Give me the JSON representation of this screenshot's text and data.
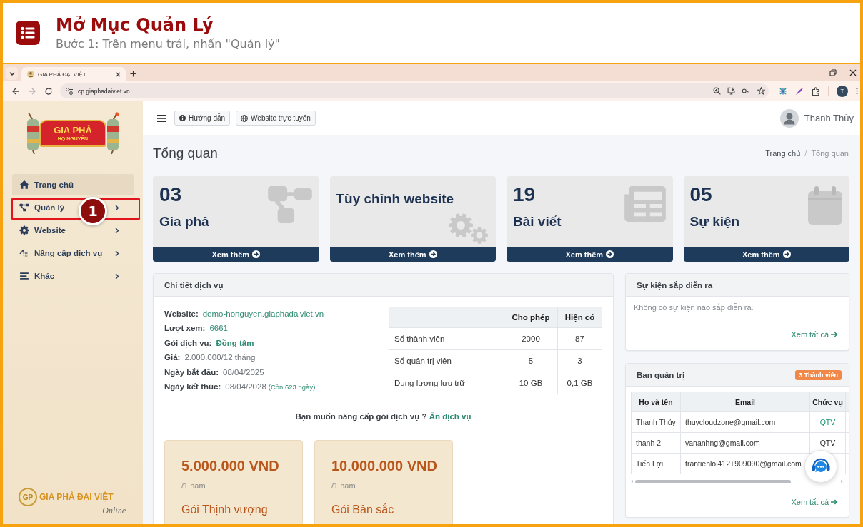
{
  "tutorial": {
    "title": "Mở Mục Quản Lý",
    "subtitle": "Bước 1: Trên menu trái, nhấn \"Quản lý\""
  },
  "browser": {
    "tabs": [
      {
        "title": "GIA PHẢ ĐẠI VIỆT",
        "selected": true
      }
    ],
    "forward_disabled": true,
    "address": "cp.giaphadaiviet.vn",
    "profile_initial": "T"
  },
  "sidebar": {
    "logo": {
      "title": "GIA PHẢ",
      "subtitle": "HỌ NGUYỄN"
    },
    "items": [
      {
        "label": "Trang chủ",
        "selected": true,
        "highlighted": false,
        "has_submenu": false
      },
      {
        "label": "Quản lý",
        "selected": false,
        "highlighted": true,
        "has_submenu": true
      },
      {
        "label": "Website",
        "selected": false,
        "highlighted": false,
        "has_submenu": true
      },
      {
        "label": "Nâng cấp dịch vụ",
        "selected": false,
        "highlighted": false,
        "has_submenu": true
      },
      {
        "label": "Khác",
        "selected": false,
        "highlighted": false,
        "has_submenu": true
      }
    ],
    "step_marker": "1",
    "footer_logo": {
      "emblem": "GP",
      "name": "GIA PHẢ ĐẠI VIỆT",
      "tagline": "Online"
    }
  },
  "navbar": {
    "buttons": [
      {
        "label": "Hướng dẫn"
      },
      {
        "label": "Website trực tuyến"
      }
    ],
    "user_name": "Thanh Thủy"
  },
  "page": {
    "title": "Tổng quan",
    "breadcrumb": [
      {
        "label": "Trang chủ",
        "selected": false
      },
      {
        "label": "Tổng quan",
        "selected": true
      }
    ],
    "breadcrumb_separator": "/"
  },
  "stat_cards": [
    {
      "kind": "count",
      "value": "03",
      "label": "Gia phả",
      "link": "Xem thêm"
    },
    {
      "kind": "shortcut",
      "title": "Tùy chỉnh website",
      "link": "Xem thêm"
    },
    {
      "kind": "count",
      "value": "19",
      "label": "Bài viết",
      "link": "Xem thêm"
    },
    {
      "kind": "count",
      "value": "05",
      "label": "Sự kiện",
      "link": "Xem thêm"
    }
  ],
  "service_details": {
    "title": "Chi tiết dịch vụ",
    "fields": [
      {
        "label": "Website:",
        "value": "demo-honguyen.giaphadaiviet.vn",
        "kind": "link"
      },
      {
        "label": "Lượt xem:",
        "value": "6661",
        "kind": "link"
      },
      {
        "label": "Gói dịch vụ:",
        "value": "Đồng tâm",
        "kind": "strong"
      },
      {
        "label": "Giá:",
        "value": "2.000.000/12 tháng",
        "kind": "plain"
      },
      {
        "label": "Ngày bắt đầu:",
        "value": "08/04/2025",
        "kind": "plain"
      },
      {
        "label": "Ngày kết thúc:",
        "value": "08/04/2028",
        "kind": "plain",
        "note": "(Còn 623 ngày)"
      }
    ],
    "quota_table": {
      "columns": [
        "Cho phép",
        "Hiện có"
      ],
      "rows": [
        {
          "item": "Số thành viên",
          "allowed": "2000",
          "current": "87"
        },
        {
          "item": "Số quản trị viên",
          "allowed": "5",
          "current": "3"
        },
        {
          "item": "Dung lượng lưu trữ",
          "allowed": "10 GB",
          "current": "0,1 GB"
        }
      ]
    },
    "upgrade_prompt": {
      "text": "Bạn muốn nâng cấp gói dịch vụ ?",
      "link": "Ẩn dịch vụ"
    },
    "plans": [
      {
        "price": "5.000.000 VND",
        "period": "/1 năm",
        "name": "Gói Thịnh vượng"
      },
      {
        "price": "10.000.000 VND",
        "period": "/1 năm",
        "name": "Gói Bản sắc"
      }
    ]
  },
  "upcoming_events": {
    "title": "Sự kiện sắp diễn ra",
    "empty_text": "Không có sự kiện nào sắp diễn ra.",
    "link": "Xem tất cả"
  },
  "administrators": {
    "title": "Ban quản trị",
    "badge": "3 Thành viên",
    "columns": [
      "Họ và tên",
      "Email",
      "Chức vụ"
    ],
    "rows": [
      {
        "name": "Thanh Thủy",
        "email": "thuycloudzone@gmail.com",
        "role": "QTV",
        "role_highlighted": true
      },
      {
        "name": "thanh 2",
        "email": "vananhng@gmail.com",
        "role": "QTV",
        "role_highlighted": false
      },
      {
        "name": "Tiến Lợi",
        "email": "trantienloi412+909090@gmail.com"
      }
    ],
    "link": "Xem tất cả"
  }
}
